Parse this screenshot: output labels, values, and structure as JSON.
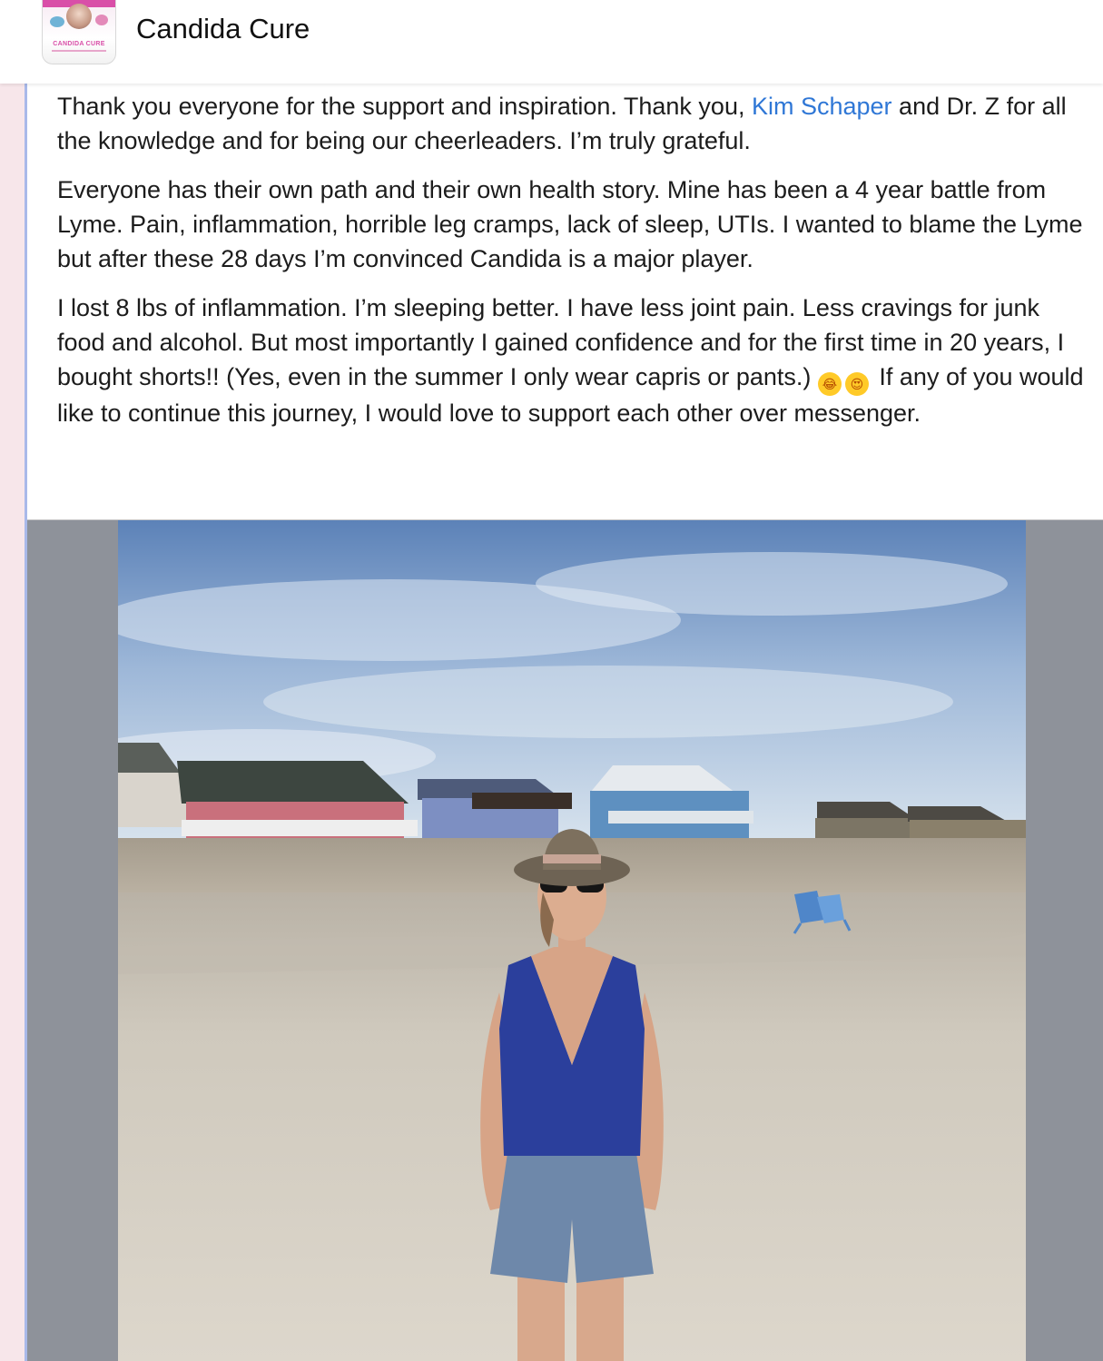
{
  "header": {
    "page_name": "Candida Cure",
    "avatar_text": "CANDIDA CURE"
  },
  "post": {
    "p1_a": "Thank you everyone for the support and inspiration.  Thank you, ",
    "p1_mention": "Kim Schaper",
    "p1_b": " and Dr. Z for all the knowledge and for being our cheerleaders.  I’m truly grateful.",
    "p2": "Everyone has their own path and their own health story.  Mine has been a 4 year battle from Lyme.  Pain, inflammation, horrible leg cramps, lack of sleep, UTIs.  I wanted to blame the Lyme but after these 28 days I’m convinced Candida is a major player.",
    "p3_a": "I lost 8 lbs of inflammation.  I’m sleeping better. I have less joint pain.  Less cravings for junk food and alcohol.  But most importantly I gained confidence and for the first time in 20 years, I bought shorts!!  (Yes, even in the summer I only wear capris or pants.) ",
    "emoji_1": "laughing-tears-emoji",
    "emoji_2": "heart-eyes-emoji",
    "p3_b": " If any of you would like to continue this journey, I would love to support each other over messenger."
  },
  "colors": {
    "mention": "#2f77d6",
    "text": "#1c1c1c",
    "photo_margin": "#8e929a",
    "left_strip": "#f7e6ea",
    "left_line": "#a9b9e9"
  }
}
